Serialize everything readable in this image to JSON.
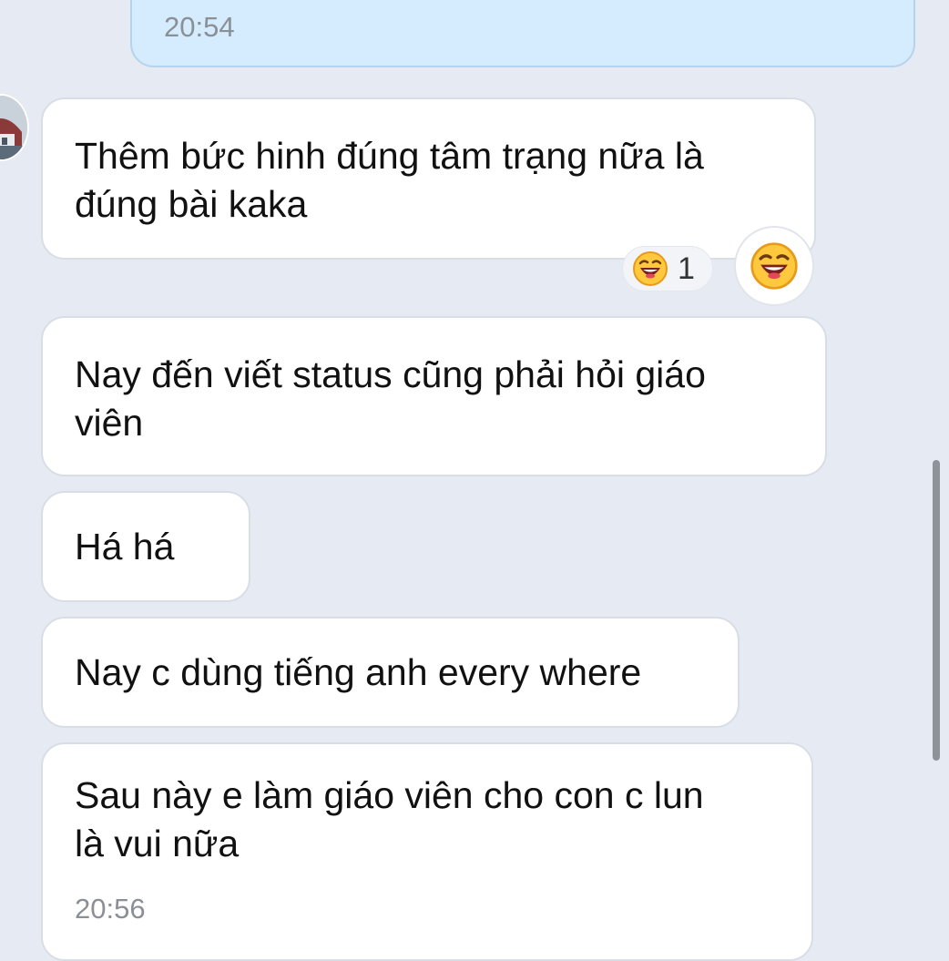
{
  "messages": [
    {
      "id": "sent-1",
      "direction": "sent",
      "time": "20:54"
    },
    {
      "id": "recv-1",
      "direction": "received",
      "text": "Thêm bức hinh đúng tâm trạng nữa là\nđúng bài kaka",
      "reaction": {
        "emoji": "laughing-face",
        "count": "1"
      }
    },
    {
      "id": "recv-2",
      "direction": "received",
      "text": "Nay đến viết status cũng phải hỏi giáo\nviên"
    },
    {
      "id": "recv-3",
      "direction": "received",
      "text": "Há há"
    },
    {
      "id": "recv-4",
      "direction": "received",
      "text": "Nay c dùng tiếng anh every where"
    },
    {
      "id": "recv-5",
      "direction": "received",
      "text": "Sau này e làm giáo viên cho con c lun\nlà vui nữa",
      "time": "20:56"
    }
  ],
  "icons": {
    "reaction_small": "laughing-emoji-icon",
    "reaction_button": "laughing-emoji-icon"
  },
  "colors": {
    "background": "#e6eaf2",
    "sent_bubble": "#d4ecfe",
    "received_bubble": "#ffffff",
    "timestamp": "#8b8f96"
  }
}
